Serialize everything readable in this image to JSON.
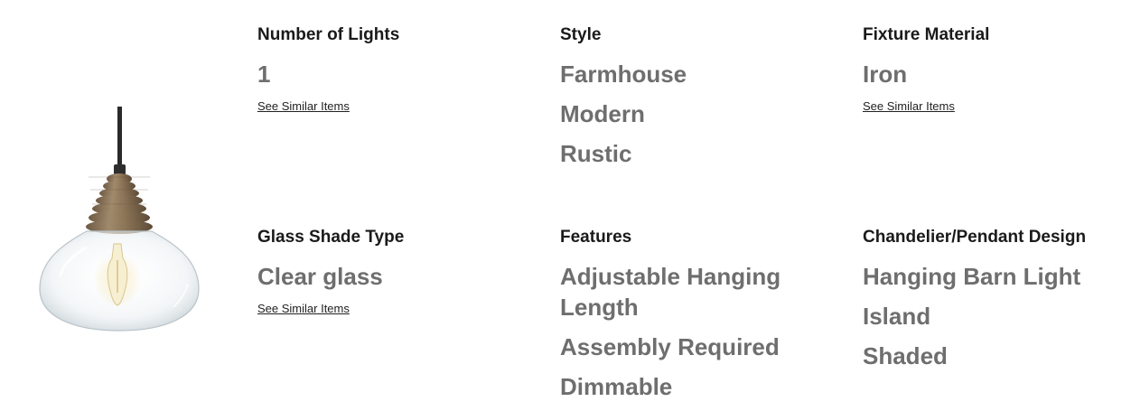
{
  "specs": {
    "number_of_lights": {
      "title": "Number of Lights",
      "values": [
        "1"
      ],
      "link": "See Similar Items"
    },
    "style": {
      "title": "Style",
      "values": [
        "Farmhouse",
        "Modern",
        "Rustic"
      ]
    },
    "fixture_material": {
      "title": "Fixture Material",
      "values": [
        "Iron"
      ],
      "link": "See Similar Items"
    },
    "glass_shade_type": {
      "title": "Glass Shade Type",
      "values": [
        "Clear glass"
      ],
      "link": "See Similar Items"
    },
    "features": {
      "title": "Features",
      "values": [
        "Adjustable Hanging Length",
        "Assembly Required",
        "Dimmable"
      ]
    },
    "chandelier_pendant_design": {
      "title": "Chandelier/Pendant Design",
      "values": [
        "Hanging Barn Light",
        "Island",
        "Shaded"
      ]
    }
  },
  "colors": {
    "title_text": "#1a1a1a",
    "value_text": "#6e6e6e",
    "link_text": "#222222"
  }
}
